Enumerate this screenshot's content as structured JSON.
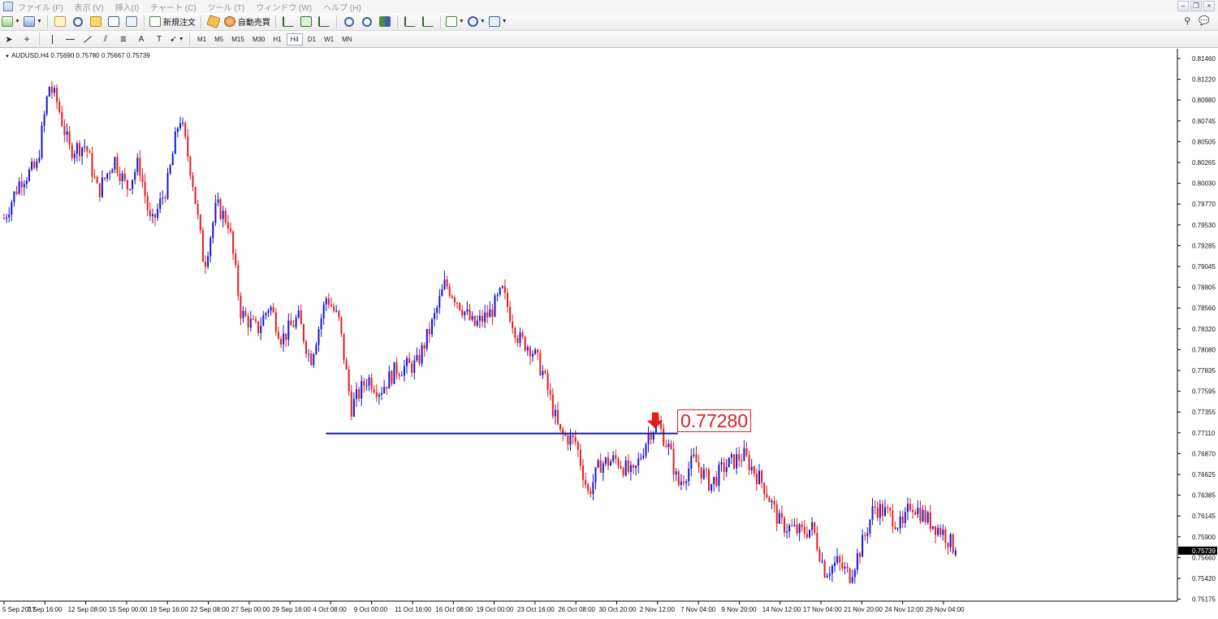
{
  "menubar": {
    "items": [
      "ファイル (F)",
      "表示 (V)",
      "挿入(I)",
      "チャート (C)",
      "ツール (T)",
      "ウィンドウ (W)",
      "ヘルプ (H)"
    ]
  },
  "toolbar": {
    "new_order_label": "新規注文",
    "auto_trade_label": "自動売買",
    "timeframes": [
      "M1",
      "M5",
      "M15",
      "M30",
      "H1",
      "H4",
      "D1",
      "W1",
      "MN"
    ],
    "active_timeframe": "H4"
  },
  "chart": {
    "symbol_label": "AUDUSD,H4  0.75690 0.75780 0.75667 0.75739",
    "price_tag": "0.77280",
    "colors": {
      "bull": "#1414d2",
      "bear": "#e01e1e",
      "line": "#1a1aa8",
      "arrow": "#e01e1e"
    }
  },
  "chart_data": {
    "type": "candlestick",
    "symbol": "AUDUSD",
    "timeframe": "H4",
    "ohlc_last": {
      "open": 0.7569,
      "high": 0.7578,
      "low": 0.75667,
      "close": 0.75739
    },
    "y_ticks": [
      "0.81460",
      "0.81220",
      "0.80980",
      "0.80745",
      "0.80505",
      "0.80265",
      "0.80030",
      "0.79770",
      "0.79530",
      "0.79285",
      "0.79045",
      "0.78805",
      "0.78560",
      "0.78320",
      "0.78080",
      "0.77835",
      "0.77595",
      "0.77355",
      "0.77110",
      "0.76870",
      "0.76625",
      "0.76385",
      "0.76145",
      "0.75900",
      "0.75660",
      "0.75420",
      "0.75175"
    ],
    "ylim": [
      0.75175,
      0.8146
    ],
    "current_price_label": "0.75739",
    "current_price": 0.75739,
    "x_ticks": [
      "5 Sep 2017",
      "7 Sep 16:00",
      "12 Sep 08:00",
      "15 Sep 00:00",
      "19 Sep 16:00",
      "22 Sep 08:00",
      "27 Sep 00:00",
      "29 Sep 16:00",
      "4 Oct 08:00",
      "9 Oct 00:00",
      "11 Oct 16:00",
      "16 Oct 08:00",
      "19 Oct 00:00",
      "23 Oct 16:00",
      "26 Oct 08:00",
      "30 Oct 20:00",
      "2 Nov 12:00",
      "7 Nov 04:00",
      "9 Nov 20:00",
      "14 Nov 12:00",
      "17 Nov 04:00",
      "21 Nov 20:00",
      "24 Nov 12:00",
      "29 Nov 04:00"
    ],
    "horizontal_line": {
      "price": 0.7728,
      "from_tick": "4 Oct 08:00",
      "to_tick": "2 Nov 12:00"
    },
    "annotation_arrow": {
      "direction": "down",
      "near_tick": "2 Nov 12:00"
    },
    "path_points": [
      {
        "x": 0,
        "y": 0.796
      },
      {
        "x": 0.4,
        "y": 0.8005
      },
      {
        "x": 0.8,
        "y": 0.802
      },
      {
        "x": 1.1,
        "y": 0.8115
      },
      {
        "x": 1.3,
        "y": 0.8095
      },
      {
        "x": 1.6,
        "y": 0.804
      },
      {
        "x": 2.0,
        "y": 0.8045
      },
      {
        "x": 2.3,
        "y": 0.799
      },
      {
        "x": 2.7,
        "y": 0.803
      },
      {
        "x": 3.0,
        "y": 0.7995
      },
      {
        "x": 3.3,
        "y": 0.8025
      },
      {
        "x": 3.6,
        "y": 0.795
      },
      {
        "x": 4.0,
        "y": 0.8
      },
      {
        "x": 4.3,
        "y": 0.808
      },
      {
        "x": 4.6,
        "y": 0.801
      },
      {
        "x": 4.9,
        "y": 0.7905
      },
      {
        "x": 5.2,
        "y": 0.7975
      },
      {
        "x": 5.5,
        "y": 0.7955
      },
      {
        "x": 5.8,
        "y": 0.785
      },
      {
        "x": 6.2,
        "y": 0.783
      },
      {
        "x": 6.5,
        "y": 0.786
      },
      {
        "x": 6.8,
        "y": 0.782
      },
      {
        "x": 7.2,
        "y": 0.7845
      },
      {
        "x": 7.5,
        "y": 0.7795
      },
      {
        "x": 7.9,
        "y": 0.787
      },
      {
        "x": 8.2,
        "y": 0.784
      },
      {
        "x": 8.5,
        "y": 0.774
      },
      {
        "x": 8.9,
        "y": 0.7775
      },
      {
        "x": 9.2,
        "y": 0.776
      },
      {
        "x": 9.6,
        "y": 0.7785
      },
      {
        "x": 10.1,
        "y": 0.779
      },
      {
        "x": 10.5,
        "y": 0.784
      },
      {
        "x": 10.8,
        "y": 0.7885
      },
      {
        "x": 11.1,
        "y": 0.7865
      },
      {
        "x": 11.5,
        "y": 0.7835
      },
      {
        "x": 11.9,
        "y": 0.785
      },
      {
        "x": 12.2,
        "y": 0.7875
      },
      {
        "x": 12.6,
        "y": 0.782
      },
      {
        "x": 12.9,
        "y": 0.781
      },
      {
        "x": 13.2,
        "y": 0.778
      },
      {
        "x": 13.6,
        "y": 0.771
      },
      {
        "x": 14.0,
        "y": 0.77
      },
      {
        "x": 14.3,
        "y": 0.764
      },
      {
        "x": 14.6,
        "y": 0.7675
      },
      {
        "x": 15.0,
        "y": 0.768
      },
      {
        "x": 15.4,
        "y": 0.766
      },
      {
        "x": 15.8,
        "y": 0.7712
      },
      {
        "x": 16.0,
        "y": 0.7722
      },
      {
        "x": 16.3,
        "y": 0.769
      },
      {
        "x": 16.5,
        "y": 0.765
      },
      {
        "x": 16.9,
        "y": 0.768
      },
      {
        "x": 17.3,
        "y": 0.765
      },
      {
        "x": 17.6,
        "y": 0.767
      },
      {
        "x": 18.1,
        "y": 0.7685
      },
      {
        "x": 18.6,
        "y": 0.765
      },
      {
        "x": 19.0,
        "y": 0.7605
      },
      {
        "x": 19.5,
        "y": 0.7595
      },
      {
        "x": 19.8,
        "y": 0.76
      },
      {
        "x": 20.1,
        "y": 0.755
      },
      {
        "x": 20.4,
        "y": 0.756
      },
      {
        "x": 20.7,
        "y": 0.7545
      },
      {
        "x": 21.0,
        "y": 0.758
      },
      {
        "x": 21.3,
        "y": 0.7625
      },
      {
        "x": 21.7,
        "y": 0.7615
      },
      {
        "x": 22.0,
        "y": 0.76
      },
      {
        "x": 22.2,
        "y": 0.763
      },
      {
        "x": 22.6,
        "y": 0.761
      },
      {
        "x": 23.0,
        "y": 0.7595
      },
      {
        "x": 23.3,
        "y": 0.7574
      }
    ]
  }
}
